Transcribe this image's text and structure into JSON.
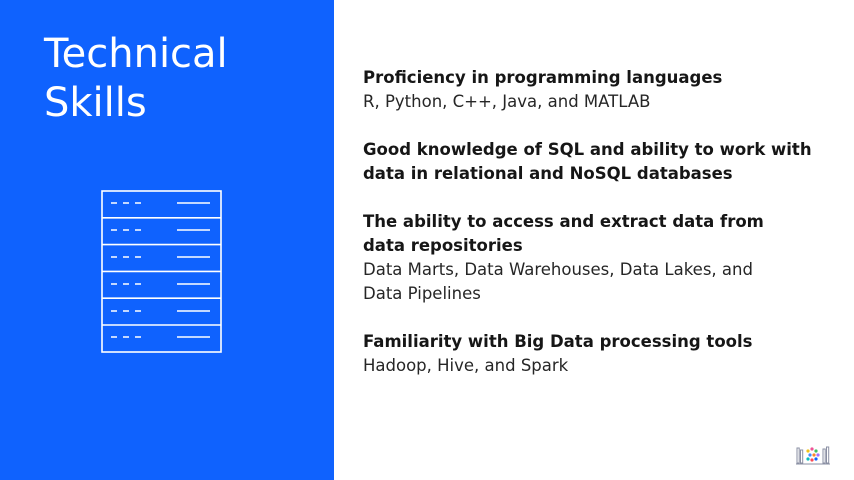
{
  "slide": {
    "title_line1": "Technical",
    "title_line2": "Skills",
    "skills": [
      {
        "heading": "Proficiency in programming languages",
        "detail": "R, Python, C++, Java, and MATLAB"
      },
      {
        "heading": "Good knowledge of SQL and ability to work with\ndata in relational and NoSQL databases",
        "detail": ""
      },
      {
        "heading": "The ability to access and extract data from\ndata repositories",
        "detail": "Data Marts, Data Warehouses, Data Lakes, and\nData Pipelines"
      },
      {
        "heading": "Familiarity with Big Data processing tools",
        "detail": "Hadoop, Hive, and Spark"
      }
    ]
  },
  "icons": {
    "illustration": "server-rack-icon",
    "brand": "library-books-icon"
  },
  "colors": {
    "panel_blue": "#0f62fe",
    "text_dark": "#161616",
    "white": "#ffffff"
  }
}
